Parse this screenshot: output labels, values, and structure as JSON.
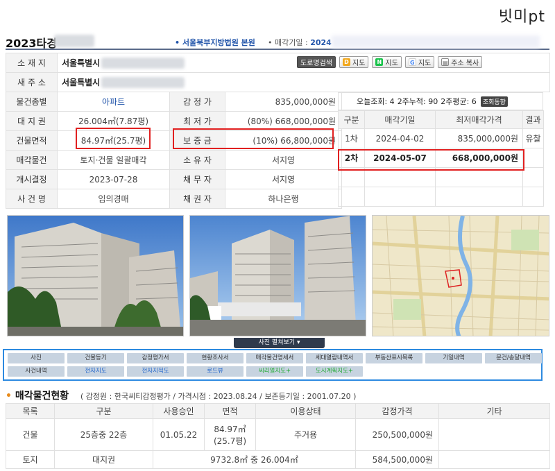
{
  "brand": "빗미pt",
  "header": {
    "case_no": "2023타경",
    "court": "서울북부지방법원 본원",
    "sale_date_label": "매각기일 :",
    "sale_date_value": "2024"
  },
  "address": {
    "location_label": "소 재 지",
    "location_value": "서울특별시",
    "new_label": "새 주 소",
    "new_value": "서울특별시"
  },
  "map_buttons": {
    "road": "도로명검색",
    "daum": "지도",
    "naver": "지도",
    "google": "지도",
    "copy": "주소 복사"
  },
  "details": [
    {
      "l1": "물건종별",
      "v1": "아파트",
      "l2": "감 정 가",
      "v2": "835,000,000원"
    },
    {
      "l1": "대 지 권",
      "v1": "26.004㎡(7.87평)",
      "l2": "최 저 가",
      "v2": "(80%) 668,000,000원"
    },
    {
      "l1": "건물면적",
      "v1": "84.97㎡(25.7평)",
      "l2": "보 증 금",
      "v2": "(10%) 66,800,000원"
    },
    {
      "l1": "매각물건",
      "v1": "토지·건물 일괄매각",
      "l2": "소 유 자",
      "v2": "서지영"
    },
    {
      "l1": "개시결정",
      "v1": "2023-07-28",
      "l2": "채 무 자",
      "v2": "서지영"
    },
    {
      "l1": "사 건 명",
      "v1": "임의경매",
      "l2": "채 권 자",
      "v2": "하나은행"
    }
  ],
  "stats": {
    "today": "오늘조회: 4",
    "two_week": "2주누적: 90",
    "avg": "2주평균: 6",
    "trend": "조회동향"
  },
  "rounds": {
    "headers": [
      "구분",
      "매각기일",
      "최저매각가격",
      "결과"
    ],
    "rows": [
      {
        "round": "1차",
        "date": "2024-04-02",
        "price": "835,000,000원",
        "result": "유찰"
      },
      {
        "round": "2차",
        "date": "2024-05-07",
        "price": "668,000,000원",
        "result": ""
      }
    ]
  },
  "more_photos": "사진 펼쳐보기",
  "links": [
    "사진",
    "건물등기",
    "감정평가서",
    "현황조사서",
    "매각물건명세서",
    "세대열람내역서",
    "부동산표시목록",
    "기일내역",
    "문건/송달내역",
    "사건내역",
    "전자지도",
    "전자지적도",
    "로드뷰",
    "씨리얼지도+",
    "도시계획지도+"
  ],
  "section": {
    "title": "매각물건현황",
    "subtitle": "( 감정원 : 한국씨티감정평가 / 가격시점 : 2023.08.24 / 보존등기일 : 2001.07.20 )"
  },
  "building_table": {
    "headers": [
      "목록",
      "구분",
      "사용승인",
      "면적",
      "이용상태",
      "감정가격",
      "기타"
    ],
    "rows": [
      {
        "list": "건물",
        "type": "25층중 22층",
        "approval": "01.05.22",
        "area": "84.97㎡",
        "area2": "(25.7평)",
        "usage": "주거용",
        "price": "250,500,000원",
        "etc": ""
      },
      {
        "list": "토지",
        "type": "대지권",
        "area": "9732.8㎡ 중 26.004㎡",
        "price": "584,500,000원"
      }
    ]
  },
  "colors": {
    "accent": "#2255aa",
    "highlight": "#e12020",
    "link_border": "#2d8ae0"
  }
}
